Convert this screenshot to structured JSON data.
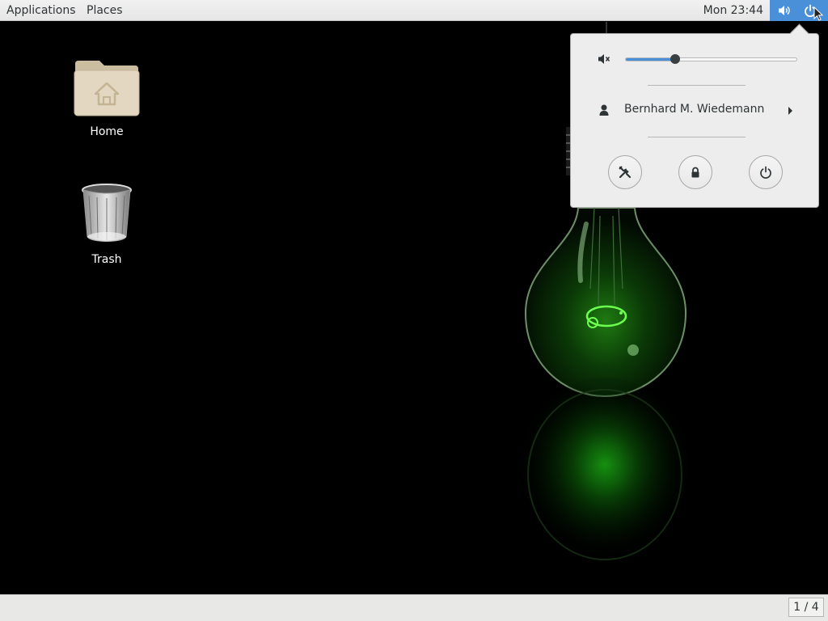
{
  "topbar": {
    "applications_label": "Applications",
    "places_label": "Places",
    "clock": "Mon 23:44",
    "icons": [
      "volume-icon",
      "power-icon"
    ]
  },
  "desktop": {
    "icons": [
      {
        "label": "Home",
        "icon": "folder-home-icon"
      },
      {
        "label": "Trash",
        "icon": "trash-icon"
      }
    ],
    "wallpaper": "green-lightbulb-chameleon"
  },
  "system_menu": {
    "volume": {
      "icon": "muted-speaker-icon",
      "level_fraction": 0.29
    },
    "user": {
      "name": "Bernhard M. Wiedemann",
      "icon": "user-icon"
    },
    "buttons": [
      {
        "name": "settings",
        "icon": "tools-icon"
      },
      {
        "name": "lock",
        "icon": "lock-icon"
      },
      {
        "name": "power",
        "icon": "power-icon"
      }
    ]
  },
  "bottombar": {
    "workspace_indicator": "1 / 4"
  },
  "colors": {
    "accent": "#4a90d9",
    "panel_bg": "#ededed",
    "bulb_glow": "#2bd426"
  }
}
